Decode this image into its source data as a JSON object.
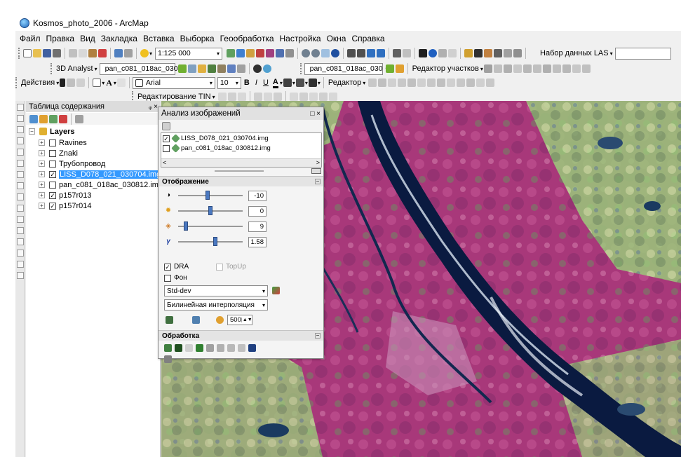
{
  "window": {
    "title": "Kosmos_photo_2006 - ArcMap"
  },
  "menu": [
    "Файл",
    "Правка",
    "Вид",
    "Закладка",
    "Вставка",
    "Выборка",
    "Геообработка",
    "Настройка",
    "Окна",
    "Справка"
  ],
  "toolbar1": {
    "scale": "1:125 000",
    "las_label": "Набор данных LAS"
  },
  "toolbar2": {
    "analyst": "3D Analyst",
    "layer_combo1": "pan_c081_018ac_030",
    "layer_combo2": "pan_c081_018ac_030",
    "parcel_editor": "Редактор участков"
  },
  "toolbar3": {
    "actions": "Действия",
    "font": "Arial",
    "font_size": "10",
    "bold": "B",
    "italic": "I",
    "underline": "U",
    "editor": "Редактор"
  },
  "toolbar4": {
    "tin_edit": "Редактирование TIN"
  },
  "toc": {
    "title": "Таблица содержания",
    "pin": "ᵩ ×",
    "root": "Layers",
    "items": [
      {
        "label": "Ravines",
        "checked": false
      },
      {
        "label": "Znaki",
        "checked": false
      },
      {
        "label": "Трубопровод",
        "checked": false
      },
      {
        "label": "LISS_D078_021_030704.img",
        "checked": true
      },
      {
        "label": "pan_c081_018ac_030812.img",
        "checked": false
      },
      {
        "label": "p157r013",
        "checked": true
      },
      {
        "label": "p157r014",
        "checked": true
      }
    ]
  },
  "panel": {
    "title": "Анализ изображений",
    "layers": [
      {
        "label": "LISS_D078_021_030704.img",
        "checked": true
      },
      {
        "label": "pan_c081_018ac_030812.img",
        "checked": false
      }
    ],
    "display_section": "Отображение",
    "sliders": [
      {
        "name": "contrast",
        "value": "-10",
        "fraction": 0.45
      },
      {
        "name": "brightness",
        "value": "0",
        "fraction": 0.5
      },
      {
        "name": "transparency",
        "value": "9",
        "fraction": 0.09
      },
      {
        "name": "gamma",
        "value": "1.58",
        "fraction": 0.58
      }
    ],
    "gamma_symbol": "γ",
    "dra": {
      "label": "DRA",
      "checked": true
    },
    "topup": {
      "label": "TopUp",
      "checked": false
    },
    "background": {
      "label": "Фон",
      "checked": false
    },
    "stretch": "Std-dev",
    "resample": "Билинейная интерполяция",
    "zoom_value": "500",
    "processing_section": "Обработка"
  },
  "colors": {
    "selection": "#3399ff",
    "river": "#0a1a40",
    "terrain": "#b0407a",
    "vegetation": "#9ad07a"
  }
}
